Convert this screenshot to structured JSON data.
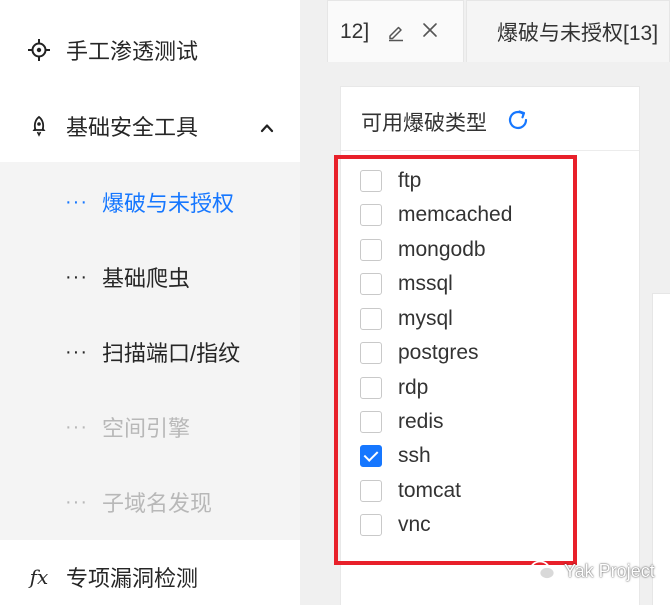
{
  "sidebar": {
    "items": [
      {
        "label": "手工渗透测试",
        "icon": "crosshair-icon"
      },
      {
        "label": "基础安全工具",
        "icon": "rocket-icon",
        "expanded": true
      },
      {
        "label": "专项漏洞检测",
        "icon": "fx-icon",
        "icon_text": "fx"
      }
    ],
    "sub_items": [
      {
        "dots": "···",
        "label": "爆破与未授权",
        "state": "active"
      },
      {
        "dots": "···",
        "label": "基础爬虫",
        "state": "normal"
      },
      {
        "dots": "···",
        "label": "扫描端口/指纹",
        "state": "normal"
      },
      {
        "dots": "···",
        "label": "空间引擎",
        "state": "disabled"
      },
      {
        "dots": "···",
        "label": "子域名发现",
        "state": "disabled"
      }
    ]
  },
  "tabs": [
    {
      "label": "12]"
    },
    {
      "label": "爆破与未授权[13]"
    }
  ],
  "panel": {
    "title": "可用爆破类型",
    "refresh_icon": "refresh-icon",
    "options": [
      {
        "label": "ftp",
        "checked": false
      },
      {
        "label": "memcached",
        "checked": false
      },
      {
        "label": "mongodb",
        "checked": false
      },
      {
        "label": "mssql",
        "checked": false
      },
      {
        "label": "mysql",
        "checked": false
      },
      {
        "label": "postgres",
        "checked": false
      },
      {
        "label": "rdp",
        "checked": false
      },
      {
        "label": "redis",
        "checked": false
      },
      {
        "label": "ssh",
        "checked": true
      },
      {
        "label": "tomcat",
        "checked": false
      },
      {
        "label": "vnc",
        "checked": false
      }
    ]
  },
  "watermark": {
    "text": "Yak Project"
  },
  "colors": {
    "accent": "#1677ff",
    "highlight": "#e8202a",
    "disabled": "#b8b8b8"
  }
}
